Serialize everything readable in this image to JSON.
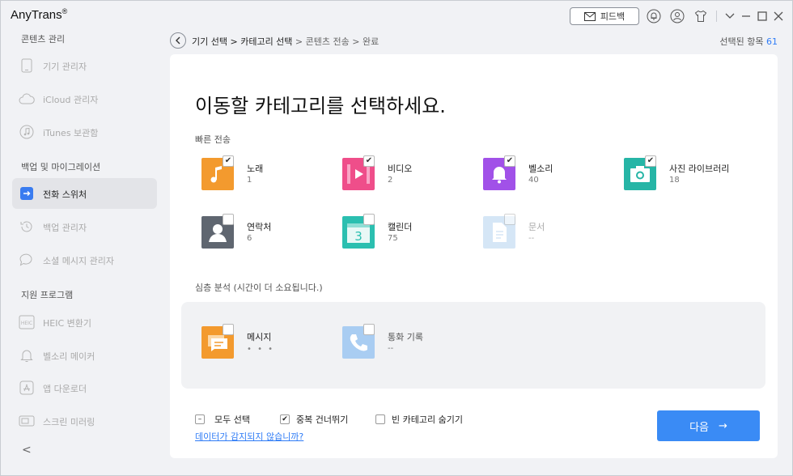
{
  "app": {
    "title": "AnyTrans",
    "reg": "®"
  },
  "titlebar": {
    "feedback_label": "피드백"
  },
  "sidebar": {
    "sections": [
      {
        "label": "콘텐츠 관리"
      },
      {
        "label": "백업 및 마이그레이션"
      },
      {
        "label": "지원 프로그램"
      }
    ],
    "items": [
      {
        "label": "기기 관리자",
        "icon": "phone-icon"
      },
      {
        "label": "iCloud 관리자",
        "icon": "cloud-icon"
      },
      {
        "label": "iTunes 보관함",
        "icon": "music-note-icon"
      },
      {
        "label": "전화 스위처",
        "icon": "phone-switch-icon"
      },
      {
        "label": "백업 관리자",
        "icon": "history-icon"
      },
      {
        "label": "소셜 메시지 관리자",
        "icon": "chat-bubble-icon"
      },
      {
        "label": "HEIC 변환기",
        "icon": "heic-icon"
      },
      {
        "label": "벨소리 메이커",
        "icon": "bell-icon"
      },
      {
        "label": "앱 다운로더",
        "icon": "app-store-icon"
      },
      {
        "label": "스크린 미러링",
        "icon": "screen-mirror-icon"
      }
    ],
    "collapse_glyph": "<"
  },
  "breadcrumb": {
    "step1": "기기 선택",
    "sep": " > ",
    "step2": "카테고리 선택",
    "step3": "콘텐츠 전송",
    "step4": "완료"
  },
  "selected": {
    "label": "선택된 항목",
    "count": "61"
  },
  "main": {
    "title": "이동할 카테고리를 선택하세요.",
    "quick_label": "빠른 전송",
    "deep_label": "심층 분석 (시간이 더 소요됩니다.)",
    "quick": [
      {
        "name": "노래",
        "count": "1",
        "checked": true,
        "color": "#f39a2e"
      },
      {
        "name": "비디오",
        "count": "2",
        "checked": true,
        "color": "#ef4e8a"
      },
      {
        "name": "벨소리",
        "count": "40",
        "checked": true,
        "color": "#a151e8"
      },
      {
        "name": "사진 라이브러리",
        "count": "18",
        "checked": true,
        "color": "#26b5a6"
      },
      {
        "name": "연락처",
        "count": "6",
        "checked": false,
        "color": "#5f6670"
      },
      {
        "name": "캘린더",
        "count": "75",
        "checked": false,
        "color": "#2bbfb0"
      },
      {
        "name": "문서",
        "count": "--",
        "checked": false,
        "color": "#8ab8e8"
      }
    ],
    "deep": [
      {
        "name": "메시지",
        "count": "• • •",
        "color": "#f39a2e"
      },
      {
        "name": "통화 기록",
        "count": "--",
        "color": "#6aa8e8"
      }
    ],
    "calendar_day": "3"
  },
  "footer": {
    "select_all": "모두 선택",
    "skip_duplicates": "중복 건너뛰기",
    "hide_empty": "빈 카테고리 숨기기",
    "link": "데이터가 감지되지 않습니까?",
    "next_label": "다음",
    "next_arrow": "→"
  }
}
